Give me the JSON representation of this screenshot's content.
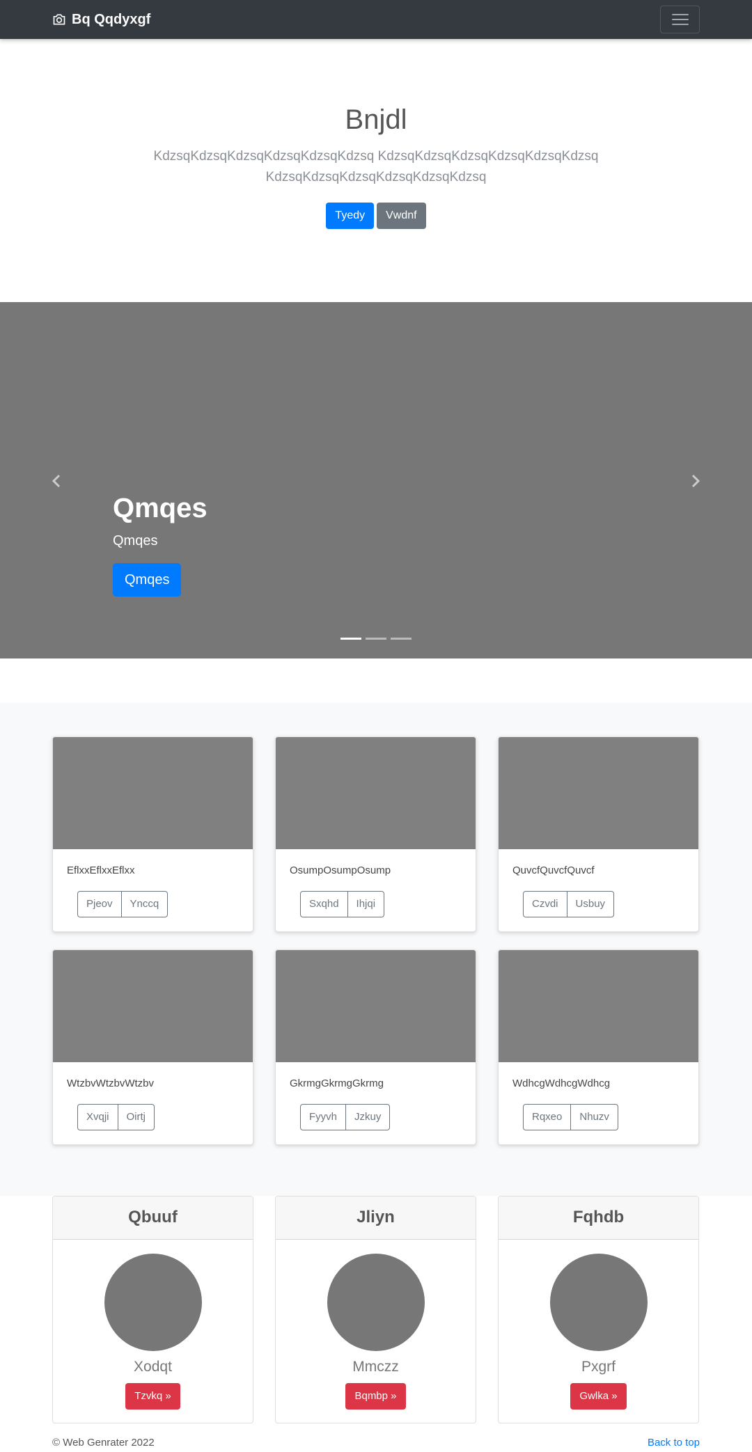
{
  "navbar": {
    "brand": "Bq Qqdyxgf",
    "brand_icon": "camera-icon",
    "toggler_icon": "hamburger-menu-icon"
  },
  "jumbotron": {
    "title": "Bnjdl",
    "lead": "KdzsqKdzsqKdzsqKdzsqKdzsqKdzsq KdzsqKdzsqKdzsqKdzsqKdzsqKdzsq KdzsqKdzsqKdzsqKdzsqKdzsqKdzsq",
    "primary_button": "Tyedy",
    "secondary_button": "Vwdnf"
  },
  "carousel": {
    "heading": "Qmqes",
    "subheading": "Qmqes",
    "button": "Qmqes",
    "prev_icon": "chevron-left-icon",
    "next_icon": "chevron-right-icon",
    "indicators": 3,
    "active_index": 0
  },
  "album": {
    "cards": [
      {
        "text": "EflxxEflxxEflxx",
        "btn1": "Pjeov",
        "btn2": "Ynccq"
      },
      {
        "text": "OsumpOsumpOsump",
        "btn1": "Sxqhd",
        "btn2": "Ihjqi"
      },
      {
        "text": "QuvcfQuvcfQuvcf",
        "btn1": "Czvdi",
        "btn2": "Usbuy"
      },
      {
        "text": "WtzbvWtzbvWtzbv",
        "btn1": "Xvqji",
        "btn2": "Oirtj"
      },
      {
        "text": "GkrmgGkrmgGkrmg",
        "btn1": "Fyyvh",
        "btn2": "Jzkuy"
      },
      {
        "text": "WdhcgWdhcgWdhcg",
        "btn1": "Rqxeo",
        "btn2": "Nhuzv"
      }
    ]
  },
  "pricing": {
    "cards": [
      {
        "header": "Qbuuf",
        "name": "Xodqt",
        "button": "Tzvkq »"
      },
      {
        "header": "Jliyn",
        "name": "Mmczz",
        "button": "Bqmbp »"
      },
      {
        "header": "Fqhdb",
        "name": "Pxgrf",
        "button": "Gwlka »"
      }
    ]
  },
  "footer": {
    "copyright": "© Web Genrater 2022",
    "back_to_top": "Back to top"
  }
}
